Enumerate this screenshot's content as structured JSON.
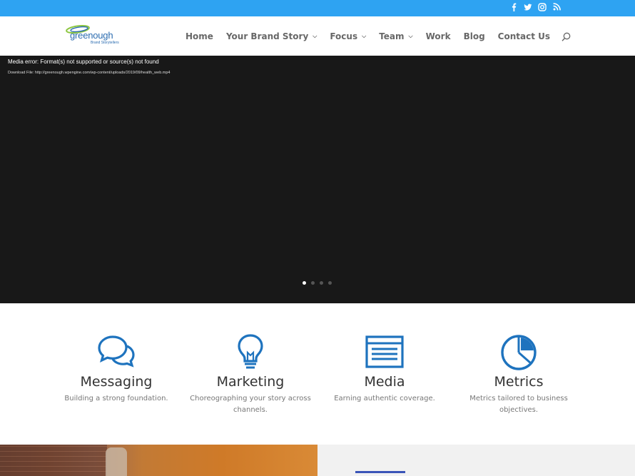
{
  "topbar": {
    "color": "#2ea3f2",
    "social": [
      {
        "icon": "facebook-icon"
      },
      {
        "icon": "twitter-icon"
      },
      {
        "icon": "instagram-icon"
      },
      {
        "icon": "rss-icon"
      }
    ]
  },
  "header": {
    "logo": {
      "word": "greenough",
      "tagline": "Brand Storytellers"
    },
    "nav": [
      {
        "label": "Home",
        "dropdown": false
      },
      {
        "label": "Your Brand Story",
        "dropdown": true
      },
      {
        "label": "Focus",
        "dropdown": true
      },
      {
        "label": "Team",
        "dropdown": true
      },
      {
        "label": "Work",
        "dropdown": false
      },
      {
        "label": "Blog",
        "dropdown": false
      },
      {
        "label": "Contact Us",
        "dropdown": false
      }
    ],
    "chevron": "⌄"
  },
  "hero": {
    "error": "Media error: Format(s) not supported or source(s) not found",
    "download": "Download File: http://greenough.wpengine.com/wp-content/uploads/2019/09/health_web.mp4",
    "slides": 4,
    "active_slide": 1
  },
  "features": [
    {
      "title": "Messaging",
      "desc": "Building a strong foundation.",
      "icon": "chat-bubbles-icon"
    },
    {
      "title": "Marketing",
      "desc": "Choreographing your story across channels.",
      "icon": "lightbulb-icon"
    },
    {
      "title": "Media",
      "desc": "Earning authentic coverage.",
      "icon": "browser-window-icon"
    },
    {
      "title": "Metrics",
      "desc": "Metrics tailored to business objectives.",
      "icon": "pie-chart-icon"
    }
  ],
  "colors": {
    "accent": "#1e73be",
    "topbar": "#2ea3f2",
    "hero_bg": "#181818",
    "underline": "#3a54b8"
  }
}
